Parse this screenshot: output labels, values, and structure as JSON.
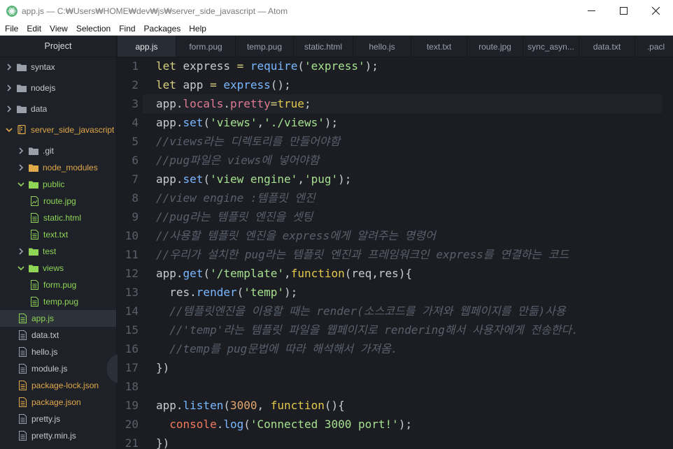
{
  "window": {
    "title": "app.js — C:₩Users₩HOME₩dev₩js₩server_side_javascript — Atom",
    "minimize": "—",
    "maximize": "☐",
    "close": "✕"
  },
  "menu": [
    "File",
    "Edit",
    "View",
    "Selection",
    "Find",
    "Packages",
    "Help"
  ],
  "sidebar": {
    "header": "Project",
    "items": [
      {
        "label": "syntax",
        "type": "folder",
        "expanded": false,
        "depth": 0,
        "color": "plain"
      },
      {
        "label": "nodejs",
        "type": "folder",
        "expanded": false,
        "depth": 0,
        "color": "plain"
      },
      {
        "label": "data",
        "type": "folder",
        "expanded": false,
        "depth": 0,
        "color": "plain"
      },
      {
        "label": "server_side_javascript",
        "type": "repo",
        "expanded": true,
        "depth": 0,
        "color": "orange"
      },
      {
        "label": ".git",
        "type": "folder",
        "expanded": false,
        "depth": 1,
        "color": "plain"
      },
      {
        "label": "node_modules",
        "type": "folder",
        "expanded": false,
        "depth": 1,
        "color": "orange"
      },
      {
        "label": "public",
        "type": "folder",
        "expanded": true,
        "depth": 1,
        "color": "green"
      },
      {
        "label": "route.jpg",
        "type": "image",
        "depth": 2,
        "color": "green"
      },
      {
        "label": "static.html",
        "type": "file",
        "depth": 2,
        "color": "green"
      },
      {
        "label": "text.txt",
        "type": "file",
        "depth": 2,
        "color": "green"
      },
      {
        "label": "test",
        "type": "folder",
        "expanded": false,
        "depth": 1,
        "color": "green"
      },
      {
        "label": "views",
        "type": "folder",
        "expanded": true,
        "depth": 1,
        "color": "green"
      },
      {
        "label": "form.pug",
        "type": "file",
        "depth": 2,
        "color": "green"
      },
      {
        "label": "temp.pug",
        "type": "file",
        "depth": 2,
        "color": "green"
      },
      {
        "label": "app.js",
        "type": "file",
        "depth": 1,
        "color": "green",
        "selected": true
      },
      {
        "label": "data.txt",
        "type": "file",
        "depth": 1,
        "color": "plain"
      },
      {
        "label": "hello.js",
        "type": "file",
        "depth": 1,
        "color": "plain"
      },
      {
        "label": "module.js",
        "type": "file",
        "depth": 1,
        "color": "plain"
      },
      {
        "label": "package-lock.json",
        "type": "file",
        "depth": 1,
        "color": "orange"
      },
      {
        "label": "package.json",
        "type": "file",
        "depth": 1,
        "color": "orange"
      },
      {
        "label": "pretty.js",
        "type": "file",
        "depth": 1,
        "color": "plain"
      },
      {
        "label": "pretty.min.js",
        "type": "file",
        "depth": 1,
        "color": "plain"
      }
    ],
    "collapse_glyph": "‹"
  },
  "tabs": [
    {
      "label": "app.js",
      "active": true
    },
    {
      "label": "form.pug"
    },
    {
      "label": "temp.pug"
    },
    {
      "label": "static.html"
    },
    {
      "label": "hello.js"
    },
    {
      "label": "text.txt"
    },
    {
      "label": "route.jpg"
    },
    {
      "label": "sync_asyn..."
    },
    {
      "label": "data.txt"
    },
    {
      "label": ".pacl"
    }
  ],
  "editor": {
    "cursor_line": 3,
    "lines": [
      {
        "n": "1",
        "tokens": [
          [
            "kw",
            "let"
          ],
          [
            "plain",
            " express "
          ],
          [
            "kw",
            "="
          ],
          [
            "plain",
            " "
          ],
          [
            "fn",
            "require"
          ],
          [
            "plain",
            "("
          ],
          [
            "str",
            "'express'"
          ],
          [
            "plain",
            ");"
          ]
        ]
      },
      {
        "n": "2",
        "tokens": [
          [
            "kw",
            "let"
          ],
          [
            "plain",
            " app "
          ],
          [
            "kw",
            "="
          ],
          [
            "plain",
            " "
          ],
          [
            "fn",
            "express"
          ],
          [
            "plain",
            "();"
          ]
        ]
      },
      {
        "n": "3",
        "tokens": [
          [
            "plain",
            "app."
          ],
          [
            "prop",
            "locals"
          ],
          [
            "plain",
            "."
          ],
          [
            "prop",
            "pretty"
          ],
          [
            "kw",
            "="
          ],
          [
            "key",
            "true"
          ],
          [
            "plain",
            ";"
          ]
        ]
      },
      {
        "n": "4",
        "tokens": [
          [
            "plain",
            "app."
          ],
          [
            "fn",
            "set"
          ],
          [
            "plain",
            "("
          ],
          [
            "str",
            "'views'"
          ],
          [
            "plain",
            ","
          ],
          [
            "str",
            "'./views'"
          ],
          [
            "plain",
            ");"
          ]
        ]
      },
      {
        "n": "5",
        "tokens": [
          [
            "comment",
            "//views라는 디렉토리를 만들어야함"
          ]
        ]
      },
      {
        "n": "6",
        "tokens": [
          [
            "comment",
            "//pug파일은 views에 넣어야함"
          ]
        ]
      },
      {
        "n": "7",
        "tokens": [
          [
            "plain",
            "app."
          ],
          [
            "fn",
            "set"
          ],
          [
            "plain",
            "("
          ],
          [
            "str",
            "'view engine'"
          ],
          [
            "plain",
            ","
          ],
          [
            "str",
            "'pug'"
          ],
          [
            "plain",
            ");"
          ]
        ]
      },
      {
        "n": "8",
        "tokens": [
          [
            "comment",
            "//view engine :템플릿 엔진"
          ]
        ]
      },
      {
        "n": "9",
        "tokens": [
          [
            "comment",
            "//pug라는 템플릿 엔진을 셋팅"
          ]
        ]
      },
      {
        "n": "10",
        "tokens": [
          [
            "comment",
            "//사용할 템플릿 엔진을 express에게 알려주는 명령어"
          ]
        ]
      },
      {
        "n": "11",
        "tokens": [
          [
            "comment",
            "//우리가 설치한 pug라는 템플릿 엔진과 프레임워크인 express를 연결하는 코드"
          ]
        ]
      },
      {
        "n": "12",
        "tokens": [
          [
            "plain",
            "app."
          ],
          [
            "fn",
            "get"
          ],
          [
            "plain",
            "("
          ],
          [
            "str",
            "'/template'"
          ],
          [
            "plain",
            ","
          ],
          [
            "key",
            "function"
          ],
          [
            "plain",
            "(req,res){"
          ]
        ]
      },
      {
        "n": "13",
        "tokens": [
          [
            "plain",
            "  res."
          ],
          [
            "fn",
            "render"
          ],
          [
            "plain",
            "("
          ],
          [
            "str",
            "'temp'"
          ],
          [
            "plain",
            ");"
          ]
        ]
      },
      {
        "n": "14",
        "tokens": [
          [
            "comment",
            "  //템플릿엔진을 이용할 때는 render(소스코드를 가져와 웹페이지를 만듦)사용"
          ]
        ]
      },
      {
        "n": "15",
        "tokens": [
          [
            "comment",
            "  //'temp'라는 템플릿 파일을 웹페이지로 rendering해서 사용자에게 전송한다."
          ]
        ]
      },
      {
        "n": "16",
        "tokens": [
          [
            "comment",
            "  //temp를 pug문법에 따라 해석해서 가져옴."
          ]
        ]
      },
      {
        "n": "17",
        "tokens": [
          [
            "plain",
            "})"
          ]
        ]
      },
      {
        "n": "18",
        "tokens": []
      },
      {
        "n": "19",
        "tokens": [
          [
            "plain",
            "app."
          ],
          [
            "fn",
            "listen"
          ],
          [
            "plain",
            "("
          ],
          [
            "num",
            "3000"
          ],
          [
            "plain",
            ", "
          ],
          [
            "key",
            "function"
          ],
          [
            "plain",
            "(){"
          ]
        ]
      },
      {
        "n": "20",
        "tokens": [
          [
            "plain",
            "  "
          ],
          [
            "console",
            "console"
          ],
          [
            "plain",
            "."
          ],
          [
            "fn",
            "log"
          ],
          [
            "plain",
            "("
          ],
          [
            "str",
            "'Connected 3000 port!'"
          ],
          [
            "plain",
            ");"
          ]
        ]
      },
      {
        "n": "21",
        "tokens": [
          [
            "plain",
            "})"
          ]
        ]
      }
    ]
  },
  "colors": {
    "editor_bg": "#1b1d23",
    "sidebar_bg": "#1e2127",
    "accent_green": "#8fd456",
    "accent_orange": "#e0a94a"
  }
}
